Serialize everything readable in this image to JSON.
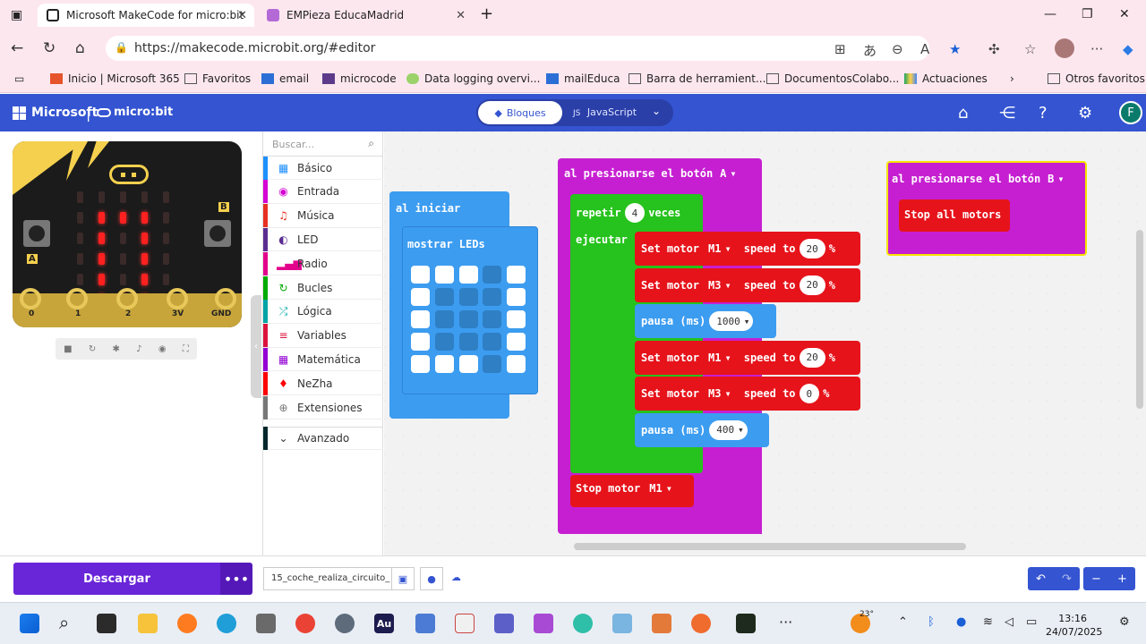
{
  "browser": {
    "tabs": [
      {
        "title": "Microsoft MakeCode for micro:bit"
      },
      {
        "title": "EMPieza EducaMadrid"
      }
    ],
    "url": "https://makecode.microbit.org/#editor",
    "favorites": [
      "Inicio | Microsoft 365",
      "Favoritos",
      "email",
      "microcode",
      "Data logging overvi...",
      "mailEduca",
      "Barra de herramient...",
      "DocumentosColabo...",
      "Actuaciones",
      "Otros favoritos"
    ]
  },
  "header": {
    "brand": "Microsoft",
    "product": "micro:bit",
    "mode_blocks": "Bloques",
    "mode_js": "JavaScript",
    "avatar_initial": "F"
  },
  "simulator": {
    "pins": [
      "0",
      "1",
      "2",
      "3V",
      "GND"
    ],
    "button_a": "A",
    "button_b": "B",
    "leds_on": [
      [
        0,
        0,
        0,
        0,
        0
      ],
      [
        0,
        1,
        1,
        1,
        0
      ],
      [
        0,
        1,
        0,
        1,
        0
      ],
      [
        0,
        1,
        0,
        1,
        0
      ],
      [
        0,
        1,
        0,
        1,
        0
      ],
      [
        0,
        1,
        1,
        1,
        0
      ]
    ]
  },
  "toolbox": {
    "search_placeholder": "Buscar...",
    "categories": [
      {
        "label": "Básico",
        "color": "#1e90ff"
      },
      {
        "label": "Entrada",
        "color": "#d400d4"
      },
      {
        "label": "Música",
        "color": "#e63022"
      },
      {
        "label": "LED",
        "color": "#5c2d91"
      },
      {
        "label": "Radio",
        "color": "#e3008c"
      },
      {
        "label": "Bucles",
        "color": "#00aa00"
      },
      {
        "label": "Lógica",
        "color": "#00a4a6"
      },
      {
        "label": "Variables",
        "color": "#dc143c"
      },
      {
        "label": "Matemática",
        "color": "#9400d3"
      },
      {
        "label": "NeZha",
        "color": "#ff0000"
      },
      {
        "label": "Extensiones",
        "color": "#777777"
      },
      {
        "label": "Avanzado",
        "color": "#00272b"
      }
    ]
  },
  "blocks": {
    "on_start": "al iniciar",
    "show_leds": "mostrar LEDs",
    "show_leds_grid": [
      [
        1,
        1,
        1,
        0,
        1
      ],
      [
        1,
        0,
        0,
        0,
        1
      ],
      [
        1,
        0,
        0,
        0,
        1
      ],
      [
        1,
        0,
        0,
        0,
        1
      ],
      [
        1,
        1,
        1,
        0,
        1
      ]
    ],
    "on_button_a_label": "al presionarse el botón",
    "on_button_a_value": "A",
    "repeat_label": "repetir",
    "repeat_count": "4",
    "repeat_times": "veces",
    "do_label": "ejecutar",
    "motor_statements": [
      {
        "kind": "motor",
        "label": "Set motor",
        "motor": "M1",
        "speed_label": "speed to",
        "speed": "20",
        "unit": "%"
      },
      {
        "kind": "motor",
        "label": "Set motor",
        "motor": "M3",
        "speed_label": "speed to",
        "speed": "20",
        "unit": "%"
      },
      {
        "kind": "pause",
        "label": "pausa (ms)",
        "value": "1000"
      },
      {
        "kind": "motor",
        "label": "Set motor",
        "motor": "M1",
        "speed_label": "speed to",
        "speed": "20",
        "unit": "%"
      },
      {
        "kind": "motor",
        "label": "Set motor",
        "motor": "M3",
        "speed_label": "speed to",
        "speed": "0",
        "unit": "%"
      },
      {
        "kind": "pause",
        "label": "pausa (ms)",
        "value": "400"
      }
    ],
    "stop_motor_label": "Stop motor",
    "stop_motor_value": "M1",
    "on_button_b_label": "al presionarse el botón",
    "on_button_b_value": "B",
    "stop_all": "Stop all motors"
  },
  "bottom": {
    "download": "Descargar",
    "filename": "15_coche_realiza_circuito_"
  },
  "taskbar": {
    "weather": "23°",
    "time": "13:16",
    "date": "24/07/2025"
  },
  "colors": {
    "makecode_blue": "#3454d1",
    "download_purple": "#6925d8",
    "event_block": "#c61fd1",
    "loop_green": "#26c21d",
    "nezha_red": "#e6131b",
    "basic_blue": "#3c9cf0"
  }
}
